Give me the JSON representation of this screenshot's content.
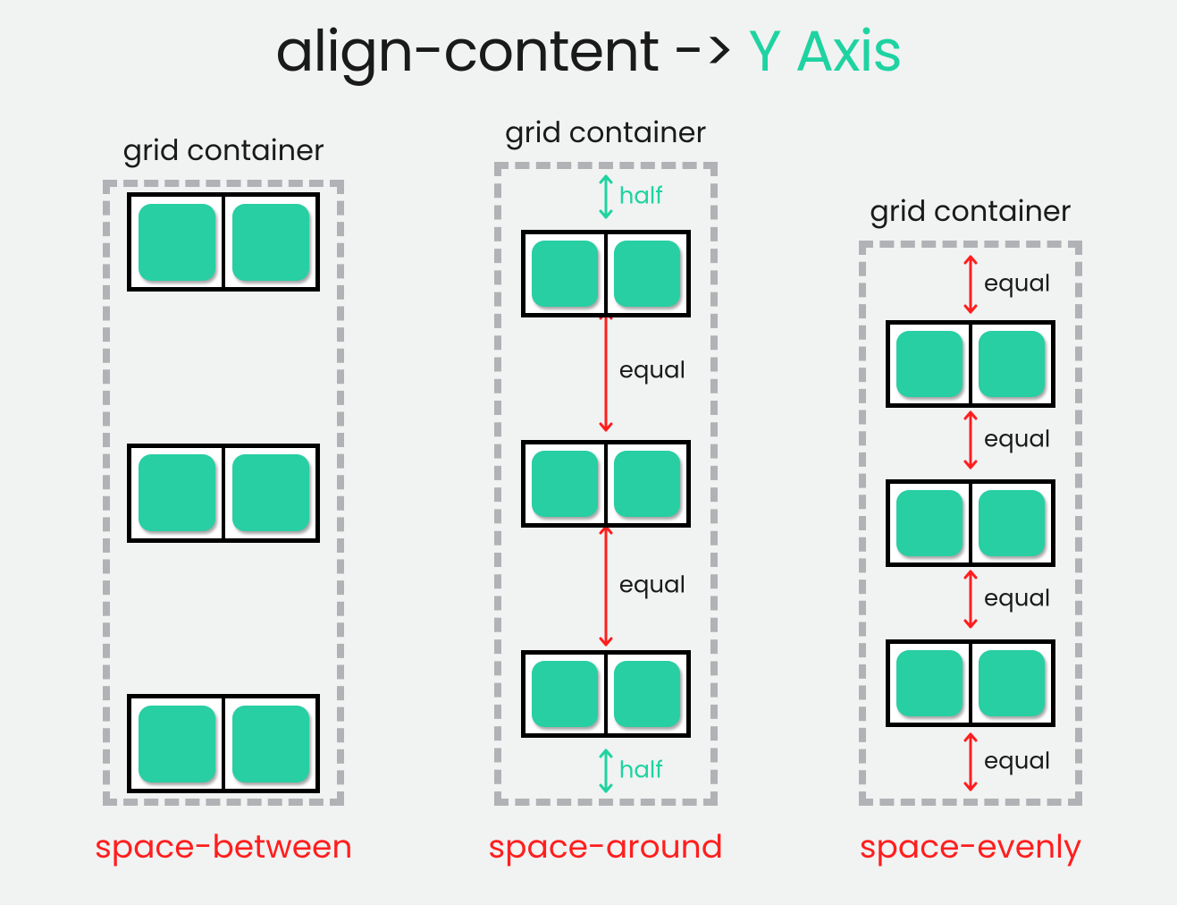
{
  "title": {
    "prefix": "align-content -> ",
    "accent": "Y Axis"
  },
  "container_label": "grid container",
  "labels": {
    "half": "half",
    "equal": "equal"
  },
  "colors": {
    "accent": "#1ed3a1",
    "red": "#ff1e1e",
    "tile": "#27cfa3",
    "dash": "#b0b2b5",
    "bg": "#f1f2f2"
  },
  "examples": [
    {
      "value": "space-between"
    },
    {
      "value": "space-around"
    },
    {
      "value": "space-evenly"
    }
  ]
}
